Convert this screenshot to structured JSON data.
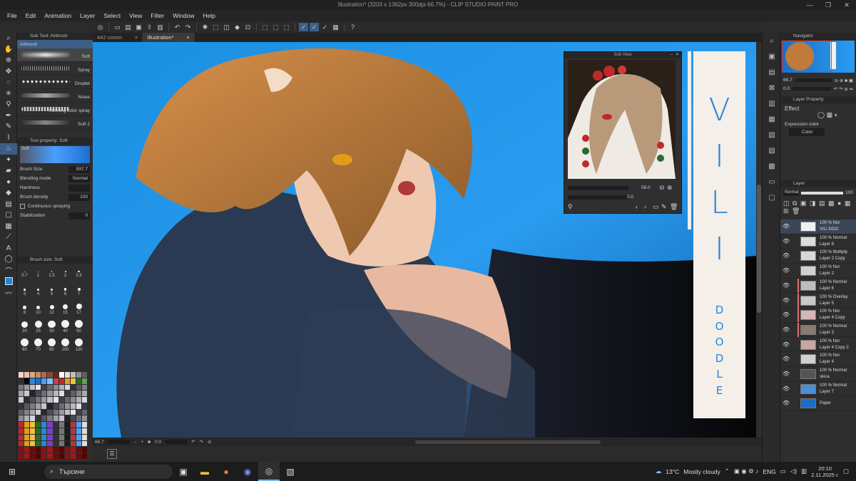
{
  "title": "Illustration* (3203 x 1362px 300dpi 66.7%) - CLIP STUDIO PAINT PRO",
  "menu": [
    "File",
    "Edit",
    "Animation",
    "Layer",
    "Select",
    "View",
    "Filter",
    "Window",
    "Help"
  ],
  "tabs": [
    {
      "label": "442 comm",
      "close": "×"
    },
    {
      "label": "Illustration*",
      "close": "×"
    }
  ],
  "subtool": {
    "header": "Sub Tool: Airbrush",
    "group": "Airbrush",
    "brushes": [
      "Soft",
      "Spray",
      "Droplet",
      "Noise",
      "Running color spray",
      "Soft 2"
    ]
  },
  "tool_property": {
    "header": "Tool property: Soft",
    "preview_label": "Soft",
    "rows": [
      {
        "label": "Brush Size",
        "value": "597.7"
      },
      {
        "label": "Blending mode",
        "value": "Normal"
      },
      {
        "label": "Hardness",
        "value": ""
      },
      {
        "label": "Brush density",
        "value": "100"
      }
    ],
    "continuous": "Continuous spraying",
    "stabilization": {
      "label": "Stabilization",
      "value": "0"
    }
  },
  "brush_size": {
    "header": "Brush size: Soft",
    "sizes": [
      "0.7",
      "1",
      "1.5",
      "2",
      "2.5",
      "3",
      "4",
      "5",
      "6",
      "7",
      "8",
      "10",
      "12",
      "15",
      "17",
      "20",
      "25",
      "30",
      "40",
      "50",
      "60",
      "70",
      "80",
      "100",
      "120"
    ]
  },
  "canvas_text": {
    "vili": [
      "V",
      "I",
      "L",
      "I"
    ],
    "doodle": [
      "D",
      "O",
      "O",
      "D",
      "L",
      "E"
    ],
    "accent": "#2f84d8"
  },
  "subview": {
    "title": "Sub View",
    "zoom": "58.0",
    "angle": "0.0"
  },
  "status": {
    "zoom": "66.7",
    "angle": "0.0"
  },
  "navigator": {
    "title": "Navigator",
    "zoom": "66.7",
    "angle": "0.0"
  },
  "layer_property": {
    "title": "Layer Property",
    "effect": "Effect",
    "expression": "Expression color",
    "color": "Color"
  },
  "layer_panel": {
    "title": "Layer",
    "blend": "Normal",
    "opacity": "100",
    "layers": [
      {
        "mode": "100 % Nor",
        "name": "VILI DOO",
        "thumb": "#f0f0f0",
        "red": false
      },
      {
        "mode": "100 % Normal",
        "name": "Layer 8",
        "thumb": "#dcdcdc",
        "red": false
      },
      {
        "mode": "100 % Multiply",
        "name": "Layer 2 Copy",
        "thumb": "#d8d8d8",
        "red": false
      },
      {
        "mode": "100 % Nor",
        "name": "Layer 2",
        "thumb": "#d0d0d0",
        "red": false
      },
      {
        "mode": "100 % Normal",
        "name": "Layer 6",
        "thumb": "#bdbdbd",
        "red": true
      },
      {
        "mode": "100 % Overlay",
        "name": "Layer 5",
        "thumb": "#c8c8c8",
        "red": true
      },
      {
        "mode": "100 % Nor",
        "name": "Layer 4 Copy",
        "thumb": "#d6b5b5",
        "red": true
      },
      {
        "mode": "100 % Normal",
        "name": "Layer 3",
        "thumb": "#8a7a70",
        "red": true
      },
      {
        "mode": "100 % Nor",
        "name": "Layer 4 Copy 2",
        "thumb": "#c9a7a0",
        "red": false
      },
      {
        "mode": "100 % Nor",
        "name": "Layer 4",
        "thumb": "#d0d0d0",
        "red": false
      },
      {
        "mode": "100 % Normal",
        "name": "skica",
        "thumb": "#555555",
        "red": false
      },
      {
        "mode": "100 % Normal",
        "name": "Layer 7",
        "thumb": "#4a8fd6",
        "red": false
      },
      {
        "mode": "",
        "name": "Paper",
        "thumb": "#1a6fc4",
        "red": false
      }
    ]
  },
  "taskbar": {
    "search_placeholder": "Търсене",
    "weather": "13°C",
    "weather_desc": "Mostly cloudy",
    "lang": "ENG",
    "time": "20:10",
    "date": "2.11.2025 г."
  }
}
